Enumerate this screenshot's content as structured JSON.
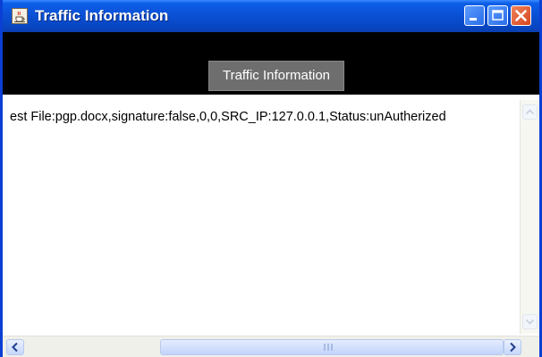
{
  "window": {
    "title": "Traffic Information",
    "icons": {
      "app": "java-cup-icon",
      "minimize": "minimize-icon",
      "maximize": "maximize-icon",
      "close": "close-icon"
    },
    "colors": {
      "titlebar": "#0a51d6",
      "close_button": "#d6451e",
      "toolbar_background": "#000000",
      "button_background": "#6e6e6e"
    }
  },
  "toolbar": {
    "traffic_button_label": "Traffic Information"
  },
  "log": {
    "lines": [
      "est File:pgp.docx,signature:false,0,0,SRC_IP:127.0.0.1,Status:unAutherized"
    ]
  },
  "scrollbars": {
    "vertical_icons": [
      "chevron-up-icon",
      "chevron-down-icon"
    ],
    "horizontal_icons": [
      "chevron-left-icon",
      "chevron-right-icon"
    ]
  }
}
